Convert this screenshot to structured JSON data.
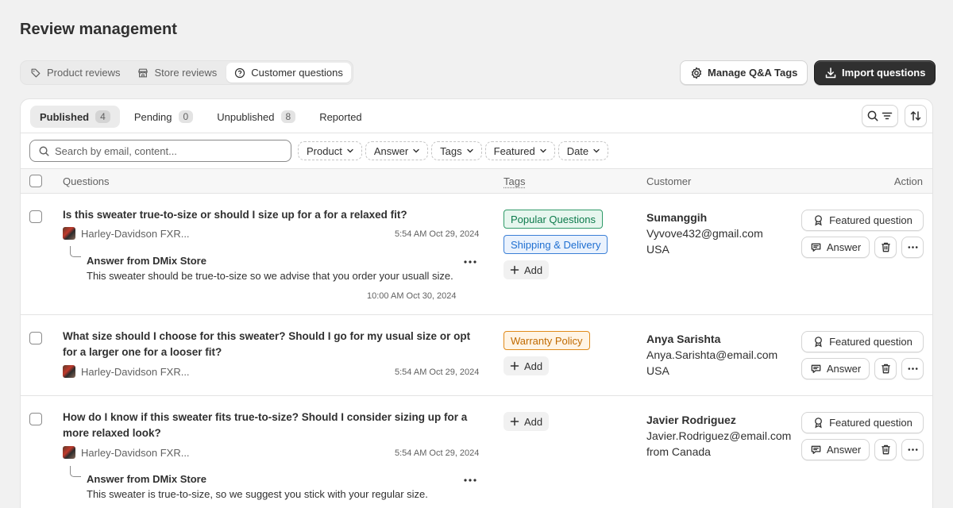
{
  "page": {
    "title": "Review management"
  },
  "segments": [
    {
      "label": "Product reviews",
      "icon": "tag-icon"
    },
    {
      "label": "Store reviews",
      "icon": "store-icon"
    },
    {
      "label": "Customer questions",
      "icon": "question-circle-icon"
    }
  ],
  "header": {
    "manage_tags_label": "Manage Q&A Tags",
    "import_label": "Import questions"
  },
  "status_tabs": [
    {
      "label": "Published",
      "count": "4"
    },
    {
      "label": "Pending",
      "count": "0"
    },
    {
      "label": "Unpublished",
      "count": "8"
    },
    {
      "label": "Reported"
    }
  ],
  "search": {
    "placeholder": "Search by email, content..."
  },
  "filters": [
    "Product",
    "Answer",
    "Tags",
    "Featured",
    "Date"
  ],
  "columns": {
    "questions": "Questions",
    "tags": "Tags",
    "customer": "Customer",
    "action": "Action"
  },
  "labels": {
    "add": "Add",
    "featured": "Featured question",
    "answer": "Answer"
  },
  "colors": {
    "tag_popular": "#0c7a4b",
    "tag_shipping": "#1f6fd1",
    "tag_warranty": "#c06a00",
    "primary_button": "#303030"
  },
  "rows": [
    {
      "question": "Is this sweater true-to-size or should I size up for a for a relaxed fit?",
      "product": "Harley-Davidson FXR...",
      "time": "5:54 AM Oct 29, 2024",
      "answer_from": "Answer from DMix Store",
      "answer": "This sweater should be true-to-size so we advise that you order your usuall size.",
      "answer_time": "10:00 AM Oct 30, 2024",
      "tags": [
        "Popular Questions",
        "Shipping & Delivery"
      ],
      "customer": {
        "name": "Sumanggih",
        "email": "Vyvove432@gmail.com",
        "location": "USA"
      }
    },
    {
      "question": "What size should I choose for this sweater? Should I go for my usual size or opt for a larger one for a looser fit?",
      "product": "Harley-Davidson FXR...",
      "time": "5:54 AM Oct 29, 2024",
      "tags": [
        "Warranty Policy"
      ],
      "customer": {
        "name": "Anya Sarishta",
        "email": "Anya.Sarishta@email.com",
        "location": "USA"
      }
    },
    {
      "question": "How do I know if this sweater fits true-to-size? Should I consider sizing up for a more relaxed look?",
      "product": "Harley-Davidson FXR...",
      "time": "5:54 AM Oct 29, 2024",
      "answer_from": "Answer from DMix Store",
      "answer": "This sweater is true-to-size, so we suggest you stick with your regular size.",
      "tags": [],
      "customer": {
        "name": "Javier Rodriguez",
        "email": "Javier.Rodriguez@email.com",
        "location": "from Canada"
      }
    }
  ]
}
